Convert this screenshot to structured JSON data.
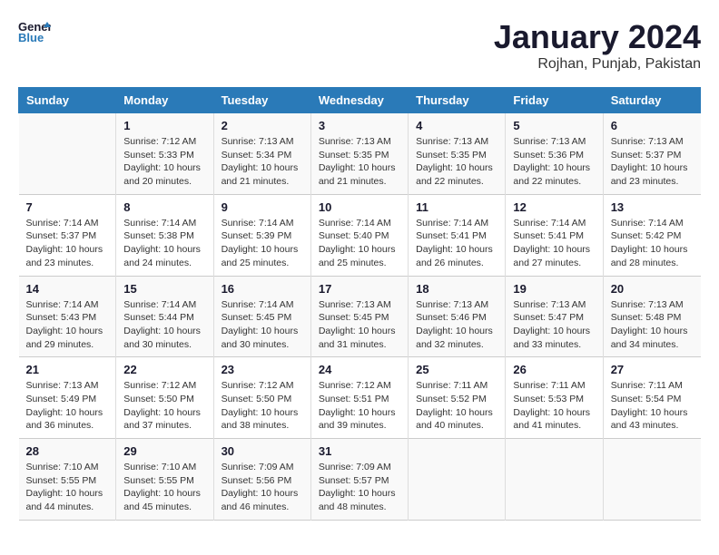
{
  "header": {
    "logo_line1": "General",
    "logo_line2": "Blue",
    "title": "January 2024",
    "subtitle": "Rojhan, Punjab, Pakistan"
  },
  "days_of_week": [
    "Sunday",
    "Monday",
    "Tuesday",
    "Wednesday",
    "Thursday",
    "Friday",
    "Saturday"
  ],
  "weeks": [
    [
      {
        "day": "",
        "info": ""
      },
      {
        "day": "1",
        "info": "Sunrise: 7:12 AM\nSunset: 5:33 PM\nDaylight: 10 hours\nand 20 minutes."
      },
      {
        "day": "2",
        "info": "Sunrise: 7:13 AM\nSunset: 5:34 PM\nDaylight: 10 hours\nand 21 minutes."
      },
      {
        "day": "3",
        "info": "Sunrise: 7:13 AM\nSunset: 5:35 PM\nDaylight: 10 hours\nand 21 minutes."
      },
      {
        "day": "4",
        "info": "Sunrise: 7:13 AM\nSunset: 5:35 PM\nDaylight: 10 hours\nand 22 minutes."
      },
      {
        "day": "5",
        "info": "Sunrise: 7:13 AM\nSunset: 5:36 PM\nDaylight: 10 hours\nand 22 minutes."
      },
      {
        "day": "6",
        "info": "Sunrise: 7:13 AM\nSunset: 5:37 PM\nDaylight: 10 hours\nand 23 minutes."
      }
    ],
    [
      {
        "day": "7",
        "info": "Sunrise: 7:14 AM\nSunset: 5:37 PM\nDaylight: 10 hours\nand 23 minutes."
      },
      {
        "day": "8",
        "info": "Sunrise: 7:14 AM\nSunset: 5:38 PM\nDaylight: 10 hours\nand 24 minutes."
      },
      {
        "day": "9",
        "info": "Sunrise: 7:14 AM\nSunset: 5:39 PM\nDaylight: 10 hours\nand 25 minutes."
      },
      {
        "day": "10",
        "info": "Sunrise: 7:14 AM\nSunset: 5:40 PM\nDaylight: 10 hours\nand 25 minutes."
      },
      {
        "day": "11",
        "info": "Sunrise: 7:14 AM\nSunset: 5:41 PM\nDaylight: 10 hours\nand 26 minutes."
      },
      {
        "day": "12",
        "info": "Sunrise: 7:14 AM\nSunset: 5:41 PM\nDaylight: 10 hours\nand 27 minutes."
      },
      {
        "day": "13",
        "info": "Sunrise: 7:14 AM\nSunset: 5:42 PM\nDaylight: 10 hours\nand 28 minutes."
      }
    ],
    [
      {
        "day": "14",
        "info": "Sunrise: 7:14 AM\nSunset: 5:43 PM\nDaylight: 10 hours\nand 29 minutes."
      },
      {
        "day": "15",
        "info": "Sunrise: 7:14 AM\nSunset: 5:44 PM\nDaylight: 10 hours\nand 30 minutes."
      },
      {
        "day": "16",
        "info": "Sunrise: 7:14 AM\nSunset: 5:45 PM\nDaylight: 10 hours\nand 30 minutes."
      },
      {
        "day": "17",
        "info": "Sunrise: 7:13 AM\nSunset: 5:45 PM\nDaylight: 10 hours\nand 31 minutes."
      },
      {
        "day": "18",
        "info": "Sunrise: 7:13 AM\nSunset: 5:46 PM\nDaylight: 10 hours\nand 32 minutes."
      },
      {
        "day": "19",
        "info": "Sunrise: 7:13 AM\nSunset: 5:47 PM\nDaylight: 10 hours\nand 33 minutes."
      },
      {
        "day": "20",
        "info": "Sunrise: 7:13 AM\nSunset: 5:48 PM\nDaylight: 10 hours\nand 34 minutes."
      }
    ],
    [
      {
        "day": "21",
        "info": "Sunrise: 7:13 AM\nSunset: 5:49 PM\nDaylight: 10 hours\nand 36 minutes."
      },
      {
        "day": "22",
        "info": "Sunrise: 7:12 AM\nSunset: 5:50 PM\nDaylight: 10 hours\nand 37 minutes."
      },
      {
        "day": "23",
        "info": "Sunrise: 7:12 AM\nSunset: 5:50 PM\nDaylight: 10 hours\nand 38 minutes."
      },
      {
        "day": "24",
        "info": "Sunrise: 7:12 AM\nSunset: 5:51 PM\nDaylight: 10 hours\nand 39 minutes."
      },
      {
        "day": "25",
        "info": "Sunrise: 7:11 AM\nSunset: 5:52 PM\nDaylight: 10 hours\nand 40 minutes."
      },
      {
        "day": "26",
        "info": "Sunrise: 7:11 AM\nSunset: 5:53 PM\nDaylight: 10 hours\nand 41 minutes."
      },
      {
        "day": "27",
        "info": "Sunrise: 7:11 AM\nSunset: 5:54 PM\nDaylight: 10 hours\nand 43 minutes."
      }
    ],
    [
      {
        "day": "28",
        "info": "Sunrise: 7:10 AM\nSunset: 5:55 PM\nDaylight: 10 hours\nand 44 minutes."
      },
      {
        "day": "29",
        "info": "Sunrise: 7:10 AM\nSunset: 5:55 PM\nDaylight: 10 hours\nand 45 minutes."
      },
      {
        "day": "30",
        "info": "Sunrise: 7:09 AM\nSunset: 5:56 PM\nDaylight: 10 hours\nand 46 minutes."
      },
      {
        "day": "31",
        "info": "Sunrise: 7:09 AM\nSunset: 5:57 PM\nDaylight: 10 hours\nand 48 minutes."
      },
      {
        "day": "",
        "info": ""
      },
      {
        "day": "",
        "info": ""
      },
      {
        "day": "",
        "info": ""
      }
    ]
  ]
}
